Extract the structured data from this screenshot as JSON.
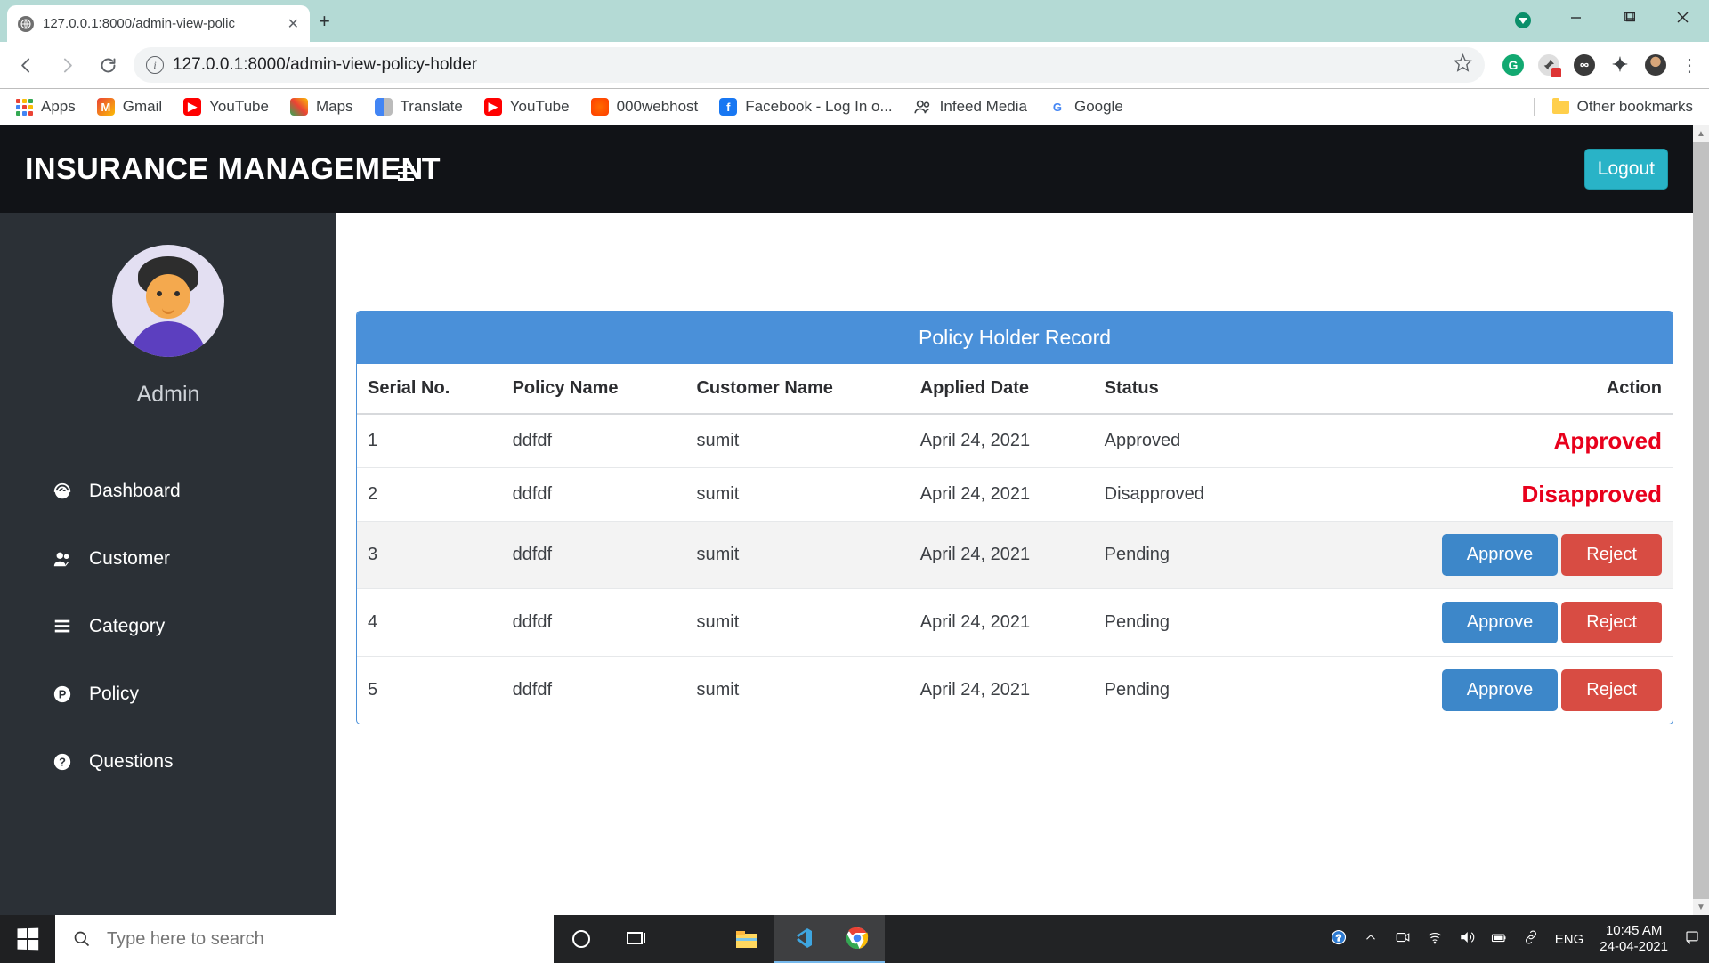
{
  "browser": {
    "tab_title": "127.0.0.1:8000/admin-view-polic",
    "url": "127.0.0.1:8000/admin-view-policy-holder",
    "bookmarks": {
      "apps": "Apps",
      "gmail": "Gmail",
      "youtube1": "YouTube",
      "maps": "Maps",
      "translate": "Translate",
      "youtube2": "YouTube",
      "webhost": "000webhost",
      "facebook": "Facebook - Log In o...",
      "infeed": "Infeed Media",
      "google": "Google",
      "other": "Other bookmarks"
    }
  },
  "header": {
    "brand": "INSURANCE MANAGEMEN",
    "logout": "Logout"
  },
  "sidebar": {
    "user": "Admin",
    "items": [
      {
        "label": "Dashboard"
      },
      {
        "label": "Customer"
      },
      {
        "label": "Category"
      },
      {
        "label": "Policy"
      },
      {
        "label": "Questions"
      }
    ]
  },
  "panel": {
    "title": "Policy Holder Record"
  },
  "table": {
    "headers": {
      "serial": "Serial No.",
      "policy": "Policy Name",
      "customer": "Customer Name",
      "applied": "Applied Date",
      "status": "Status",
      "action": "Action"
    },
    "action_labels": {
      "approve": "Approve",
      "reject": "Reject",
      "approved": "Approved",
      "disapproved": "Disapproved"
    },
    "rows": [
      {
        "serial": "1",
        "policy": "ddfdf",
        "customer": "sumit",
        "applied": "April 24, 2021",
        "status": "Approved",
        "action_type": "approved"
      },
      {
        "serial": "2",
        "policy": "ddfdf",
        "customer": "sumit",
        "applied": "April 24, 2021",
        "status": "Disapproved",
        "action_type": "disapproved"
      },
      {
        "serial": "3",
        "policy": "ddfdf",
        "customer": "sumit",
        "applied": "April 24, 2021",
        "status": "Pending",
        "action_type": "buttons"
      },
      {
        "serial": "4",
        "policy": "ddfdf",
        "customer": "sumit",
        "applied": "April 24, 2021",
        "status": "Pending",
        "action_type": "buttons"
      },
      {
        "serial": "5",
        "policy": "ddfdf",
        "customer": "sumit",
        "applied": "April 24, 2021",
        "status": "Pending",
        "action_type": "buttons"
      }
    ]
  },
  "taskbar": {
    "search_placeholder": "Type here to search",
    "lang": "ENG",
    "time": "10:45 AM",
    "date": "24-04-2021"
  }
}
